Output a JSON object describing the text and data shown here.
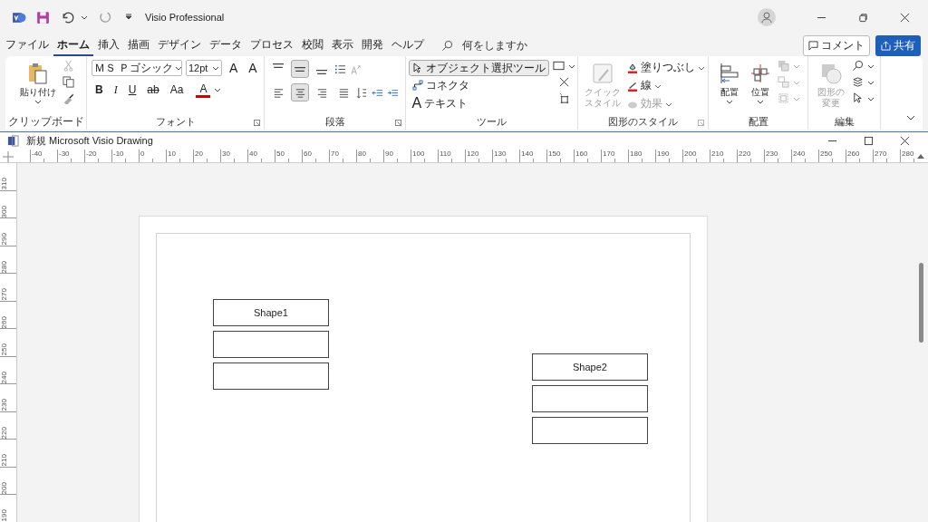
{
  "app": {
    "title": "Visio Professional"
  },
  "menu_tabs": [
    {
      "label": "ファイル",
      "selected": false
    },
    {
      "label": "ホーム",
      "selected": true
    },
    {
      "label": "挿入",
      "selected": false
    },
    {
      "label": "描画",
      "selected": false
    },
    {
      "label": "デザイン",
      "selected": false
    },
    {
      "label": "データ",
      "selected": false
    },
    {
      "label": "プロセス",
      "selected": false
    },
    {
      "label": "校閲",
      "selected": false
    },
    {
      "label": "表示",
      "selected": false
    },
    {
      "label": "開発",
      "selected": false
    },
    {
      "label": "ヘルプ",
      "selected": false
    }
  ],
  "search": {
    "placeholder": "何をしますか"
  },
  "comment_button": "コメント",
  "share_button": "共有",
  "ribbon": {
    "clipboard": {
      "paste": "貼り付け",
      "label": "クリップボード"
    },
    "font": {
      "name": "ＭＳ Ｐゴシック",
      "size": "12pt",
      "grow": "A",
      "shrink": "A",
      "styles": [
        "B",
        "I",
        "U",
        "ab",
        "Aa"
      ],
      "color_button": "A",
      "label": "フォント"
    },
    "paragraph": {
      "vertical_align": [
        {
          "selected": false
        },
        {
          "selected": true
        },
        {
          "selected": false
        }
      ],
      "horizontal_align": [
        {
          "selected": false
        },
        {
          "selected": true
        },
        {
          "selected": false
        },
        {
          "selected": false
        }
      ],
      "label": "段落"
    },
    "tools": {
      "items": [
        {
          "label": "オブジェクト選択ツール",
          "kind": "pointer",
          "selected": true
        },
        {
          "label": "コネクタ",
          "kind": "connector",
          "selected": false
        },
        {
          "label": "テキスト",
          "kind": "text",
          "glyph": "A",
          "selected": false
        }
      ],
      "label": "ツール"
    },
    "shape_styles": {
      "quick_style": {
        "label": "クイックスタイル",
        "disabled": true
      },
      "items": [
        {
          "label": "塗りつぶし",
          "kind": "fill",
          "disabled": false
        },
        {
          "label": "線",
          "kind": "line",
          "disabled": false
        },
        {
          "label": "効果",
          "kind": "effect",
          "disabled": true
        }
      ],
      "label": "図形のスタイル"
    },
    "arrange": {
      "buttons": [
        "配置",
        "位置"
      ],
      "label": "配置"
    },
    "editing": {
      "change_shape": {
        "label": "図形の変更",
        "disabled": true
      },
      "label": "編集"
    }
  },
  "document": {
    "title": "新規 Microsoft Visio Drawing"
  },
  "ruler": {
    "horizontal": [
      "-40",
      "-30",
      "-20",
      "-10",
      "0",
      "10",
      "20",
      "30",
      "40",
      "50",
      "60",
      "70",
      "80",
      "90",
      "100",
      "110",
      "120",
      "130",
      "140",
      "150",
      "160",
      "170",
      "180",
      "190",
      "200",
      "210",
      "220",
      "230",
      "240",
      "250",
      "260",
      "270",
      "280"
    ],
    "vertical": [
      "310",
      "300",
      "290",
      "280",
      "270",
      "260",
      "250",
      "240",
      "230",
      "220",
      "210",
      "200",
      "190"
    ]
  },
  "shapes": [
    {
      "label": "Shape1"
    },
    {
      "label": "Shape2"
    }
  ]
}
